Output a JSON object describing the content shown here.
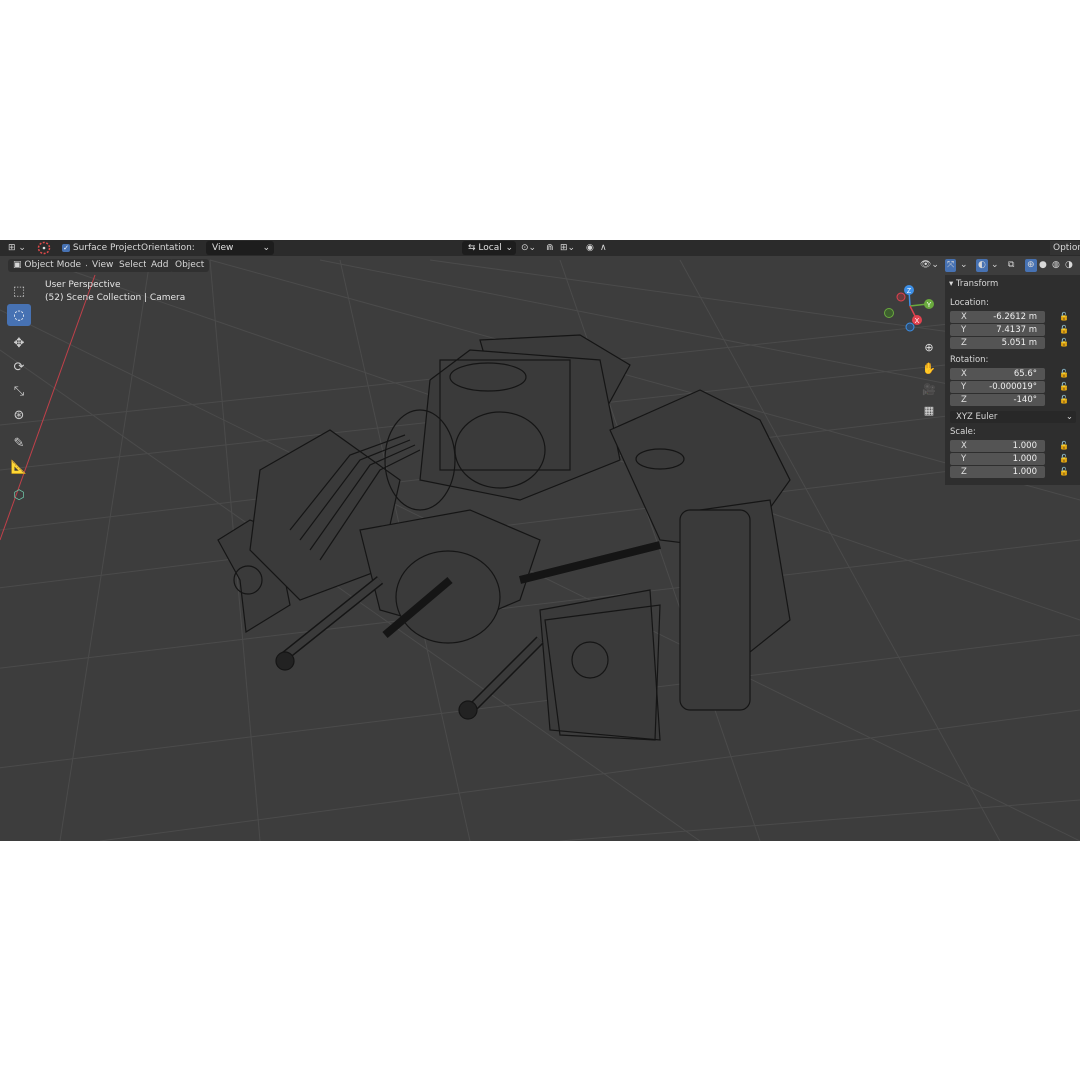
{
  "header": {
    "snap_label": "Surface Project",
    "orientation_label": "Orientation:",
    "orientation_value": "View",
    "pivot_value": "Local",
    "options_label": "Options"
  },
  "menu": {
    "mode": "Object Mode",
    "items": [
      "View",
      "Select",
      "Add",
      "Object"
    ]
  },
  "viewport": {
    "perspective": "User Perspective",
    "collection_info": "(52) Scene Collection | Camera"
  },
  "toolbar": {
    "tools": [
      "select-box",
      "cursor",
      "move",
      "rotate",
      "scale",
      "transform",
      "annotate",
      "measure",
      "add-cube"
    ]
  },
  "gizmo": {
    "x": "X",
    "y": "Y",
    "z": "Z"
  },
  "transform": {
    "title": "Transform",
    "location_label": "Location:",
    "location": [
      {
        "axis": "X",
        "value": "-6.2612 m"
      },
      {
        "axis": "Y",
        "value": "7.4137 m"
      },
      {
        "axis": "Z",
        "value": "5.051 m"
      }
    ],
    "rotation_label": "Rotation:",
    "rotation": [
      {
        "axis": "X",
        "value": "65.6°"
      },
      {
        "axis": "Y",
        "value": "-0.000019°"
      },
      {
        "axis": "Z",
        "value": "-140°"
      }
    ],
    "rotation_mode": "XYZ Euler",
    "scale_label": "Scale:",
    "scale": [
      {
        "axis": "X",
        "value": "1.000"
      },
      {
        "axis": "Y",
        "value": "1.000"
      },
      {
        "axis": "Z",
        "value": "1.000"
      }
    ]
  },
  "colors": {
    "viewport_bg": "#3d3d3d",
    "header_bg": "#2b2b2b",
    "active_tool": "#4772b3",
    "axis_x": "#e2424f",
    "axis_y": "#6aaa3e",
    "axis_z": "#3d8fe6"
  }
}
